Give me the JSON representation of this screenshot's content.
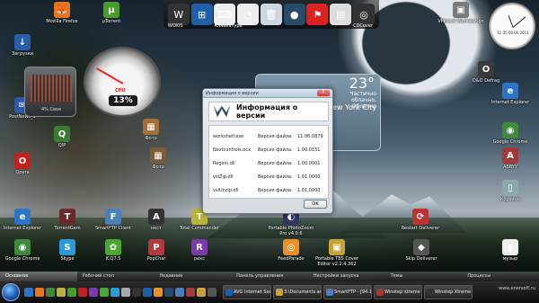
{
  "desktop": {
    "icons": [
      {
        "label": "Mozilla Firefox",
        "color": "#e8761e",
        "glyph": "🦊"
      },
      {
        "label": "µTorrent",
        "color": "#4a9b2e",
        "glyph": "µ"
      },
      {
        "label": "Загрузки",
        "color": "#2a5fa8",
        "glyph": "↓"
      },
      {
        "label": "PostNews_1",
        "color": "#2b5aa2",
        "glyph": "✉"
      },
      {
        "label": "Opera",
        "color": "#c3211f",
        "glyph": "O"
      },
      {
        "label": "QIP",
        "color": "#3a7a32",
        "glyph": "Q"
      },
      {
        "label": "Фото",
        "color": "#7a5b3a",
        "glyph": "▦"
      },
      {
        "label": "Internet Explorer",
        "color": "#2d74c4",
        "glyph": "e"
      },
      {
        "label": "TorrentGem",
        "color": "#6a2a2a",
        "glyph": "T"
      },
      {
        "label": "SmartFTP Client",
        "color": "#4a7fb8",
        "glyph": "F"
      },
      {
        "label": "нкст",
        "color": "#333",
        "glyph": "A"
      },
      {
        "label": "Total Commander",
        "color": "#b8b33a",
        "glyph": "T"
      },
      {
        "label": "Google Chrome",
        "color": "#3e8a3a",
        "glyph": "◉"
      },
      {
        "label": "Skype",
        "color": "#2b9bd8",
        "glyph": "S"
      },
      {
        "label": "ICQ7.5",
        "color": "#4aa832",
        "glyph": "✿"
      },
      {
        "label": "PopChar",
        "color": "#b33a3a",
        "glyph": "P"
      },
      {
        "label": "рекс",
        "color": "#7a3aa8",
        "glyph": "R"
      },
      {
        "label": "FeedParade",
        "color": "#e8902a",
        "glyph": "◎"
      },
      {
        "label": "Portable TBS Cover Editor v2.2.4.362",
        "color": "#c7a23a",
        "glyph": "▣"
      },
      {
        "label": "Skip Deliverer",
        "color": "#555",
        "glyph": "◆"
      },
      {
        "label": "музыр",
        "color": "#eee",
        "glyph": "▮"
      },
      {
        "label": "VMware Workstation",
        "color": "#7a7a7a",
        "glyph": "▣"
      },
      {
        "label": "O&O Defrag",
        "color": "#3a3a3a",
        "glyph": "O"
      },
      {
        "label": "Internet Explorer",
        "color": "#2d74c4",
        "glyph": "e"
      },
      {
        "label": "Google Chrome",
        "color": "#3e8a3a",
        "glyph": "◉"
      },
      {
        "label": "Корзина",
        "color": "#8aa",
        "glyph": "▯"
      },
      {
        "label": "Restart Deliverer",
        "color": "#b33",
        "glyph": "⟳"
      },
      {
        "label": "Portable PhotoZoom Pro v4.0.6",
        "color": "#336",
        "glyph": "◐"
      },
      {
        "label": "Фото",
        "color": "#a3703a",
        "glyph": "▦"
      },
      {
        "label": "ABBYY",
        "color": "#a23a3a",
        "glyph": "A"
      }
    ]
  },
  "dock": {
    "items": [
      {
        "label": "WOXIS",
        "glyph": "W",
        "color": "#333"
      },
      {
        "label": "",
        "glyph": "⊞",
        "color": "#1f5fa8"
      },
      {
        "label": "Клавиатура",
        "glyph": "⌨",
        "color": "#eee"
      },
      {
        "label": "",
        "glyph": "◔",
        "color": "#eee"
      },
      {
        "label": "",
        "glyph": "🗑",
        "color": "#cfd8df"
      },
      {
        "label": "",
        "glyph": "●",
        "color": "#2a4a6a"
      },
      {
        "label": "",
        "glyph": "⚑",
        "color": "#d22"
      },
      {
        "label": "",
        "glyph": "▤",
        "color": "#ddd"
      },
      {
        "label": "CDCover",
        "glyph": "◎",
        "color": "#333"
      }
    ]
  },
  "gauge": {
    "cpu_label": "CPU",
    "value": "13%",
    "panel_text": "4% Свое"
  },
  "weather": {
    "temperature": "23°",
    "condition": "Частично облачно, Облачно",
    "city": "New York City"
  },
  "clock": {
    "caption": "11:35 00.00.2011"
  },
  "dialog": {
    "title": "Информация о версии",
    "heading": "Информация о версии",
    "close": "X",
    "rows": [
      {
        "file": "workshelf.exe",
        "key": "Версия файла:",
        "value": "11.06.0879"
      },
      {
        "file": "Nextcontrols.ocx",
        "key": "Версия файла:",
        "value": "1.00.0151"
      },
      {
        "file": "Region.dll",
        "key": "Версия файла:",
        "value": "1.00.0001"
      },
      {
        "file": "vsiZip.dll",
        "key": "Версия файла:",
        "value": "1.01.0000"
      },
      {
        "file": "vsiUnzip.dll",
        "key": "Версия файла:",
        "value": "1.01.0000"
      }
    ],
    "ok_label": "OK"
  },
  "panel_tabs": [
    {
      "label": "Основное",
      "active": true
    },
    {
      "label": "Рабочий стол",
      "active": false
    },
    {
      "label": "Недавние",
      "active": false
    },
    {
      "label": "Панель управления",
      "active": false
    },
    {
      "label": "Настройки запуска",
      "active": false
    },
    {
      "label": "Темы",
      "active": false
    },
    {
      "label": "Процессы",
      "active": false
    }
  ],
  "taskbar": {
    "quicklaunch_colors": [
      "#2d74c4",
      "#e8761e",
      "#3e8a3a",
      "#b8b33a",
      "#4a9b2e",
      "#c3211f",
      "#7a3aa8",
      "#4aa832",
      "#2b9bd8",
      "#aaa",
      "#333",
      "#1f5fa8",
      "#e8902a",
      "#2a4a6a",
      "#4a7fb8",
      "#a23a3a",
      "#c7a23a",
      "#555"
    ],
    "tasks": [
      {
        "label": "AVG Internet Securit...",
        "color": "#1f5fa8"
      },
      {
        "label": "3:\\Documents and S...",
        "color": "#c7a23a"
      },
      {
        "label": "SmartFTP - [94.198.2...",
        "color": "#4a7fb8"
      },
      {
        "label": "Winstep xtreme v 11...",
        "color": "#a23a3a"
      },
      {
        "label": "Winstep Xtreme 11.6...",
        "color": "#333"
      }
    ],
    "tray_text": "www.enersoft.ru"
  }
}
